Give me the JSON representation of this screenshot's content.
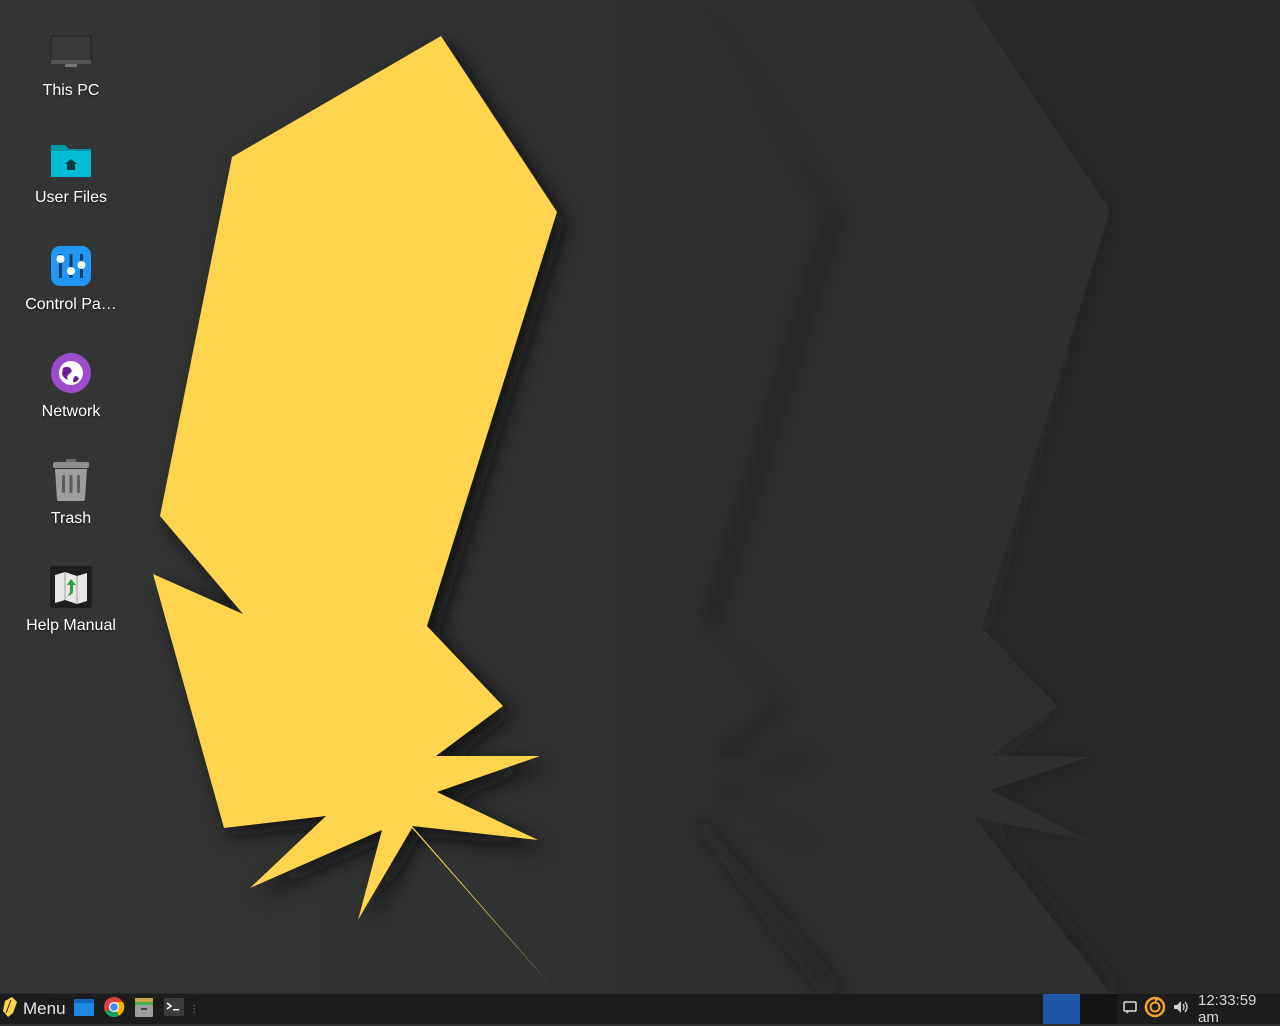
{
  "desktop": {
    "icons": [
      {
        "label": "This PC",
        "icon": "monitor-icon"
      },
      {
        "label": "User Files",
        "icon": "home-folder-icon"
      },
      {
        "label": "Control Pa…",
        "icon": "control-panel-icon"
      },
      {
        "label": "Network",
        "icon": "network-globe-icon"
      },
      {
        "label": "Trash",
        "icon": "trash-icon"
      },
      {
        "label": "Help Manual",
        "icon": "help-manual-icon"
      }
    ]
  },
  "taskbar": {
    "menu_label": "Menu",
    "launchers": [
      "file-manager-icon",
      "chrome-icon",
      "archive-icon",
      "terminal-icon"
    ],
    "clock": "12:33:59 am",
    "tray": [
      "notification-icon",
      "update-icon",
      "volume-icon"
    ]
  },
  "colors": {
    "accent_yellow": "#ffd54f",
    "taskbar_bg": "#1c1c1c",
    "workspace_active": "#1e56a8"
  }
}
